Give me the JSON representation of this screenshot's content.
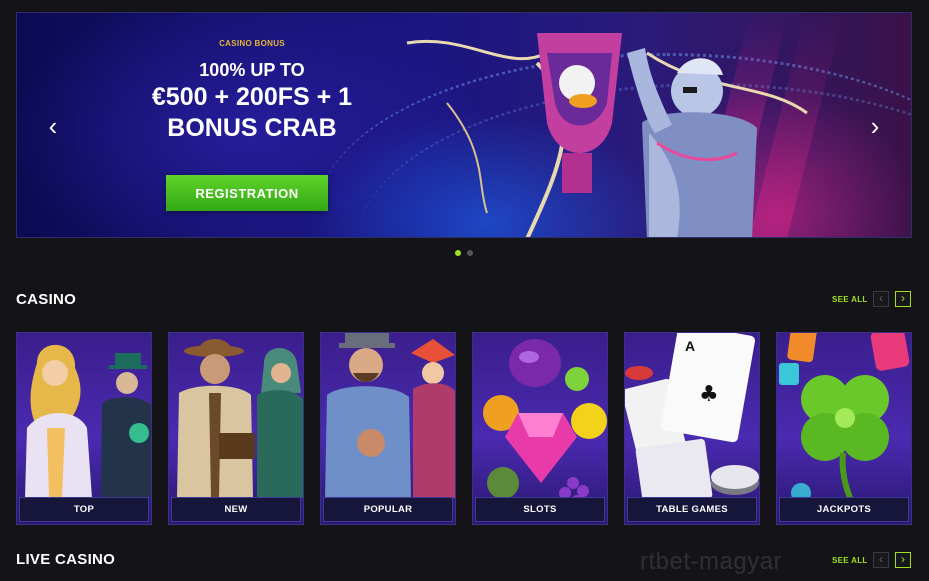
{
  "hero": {
    "kicker": "CASINO BONUS",
    "line1": "100% UP TO",
    "line2": "€500 + 200FS + 1",
    "line3": "BONUS CRAB",
    "cta_label": "REGISTRATION",
    "prev_icon": "chevron-left-icon",
    "next_icon": "chevron-right-icon",
    "slide_count": 2,
    "active_slide": 1
  },
  "casino": {
    "title": "CASINO",
    "see_all": "SEE ALL",
    "categories": [
      {
        "label": "TOP"
      },
      {
        "label": "NEW"
      },
      {
        "label": "POPULAR"
      },
      {
        "label": "SLOTS"
      },
      {
        "label": "TABLE GAMES"
      },
      {
        "label": "JACKPOTS"
      }
    ]
  },
  "live_casino": {
    "title": "LIVE CASINO",
    "see_all": "SEE ALL"
  },
  "watermark": "rtbet-magyar",
  "colors": {
    "accent": "#9fe020",
    "kicker": "#e8b43a",
    "cta": "#3fb51a",
    "background": "#141418"
  }
}
